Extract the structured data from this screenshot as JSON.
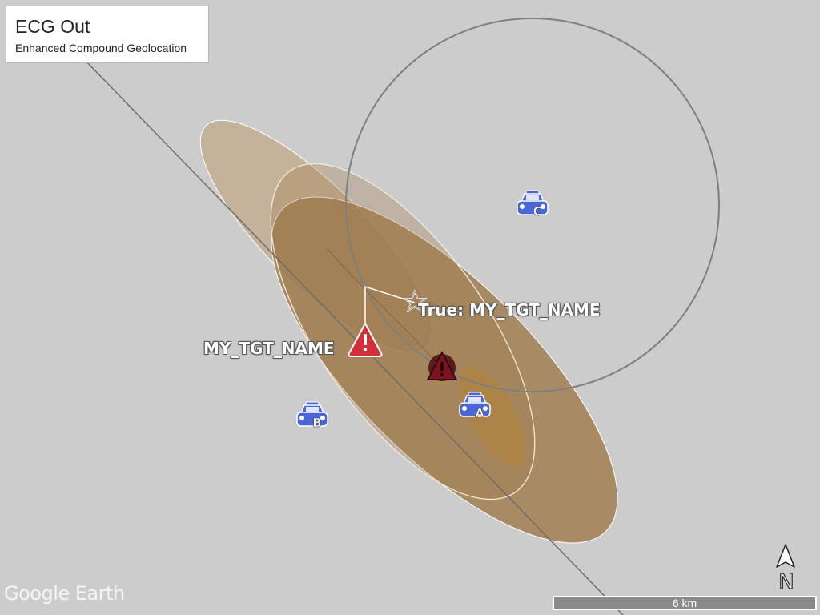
{
  "panel": {
    "title": "ECG Out",
    "subtitle": "Enhanced Compound Geolocation"
  },
  "labels": {
    "target": "MY_TGT_NAME",
    "true_target": "True: MY_TGT_NAME"
  },
  "sensors": {
    "a": "A",
    "b": "B",
    "c": "C"
  },
  "watermark": "Google Earth",
  "scale_bar": {
    "label": "6 km"
  },
  "north_arrow": {
    "label": "N"
  },
  "colors": {
    "background": "#cccccc",
    "ellipse_outer": "#a07c4e",
    "ellipse_light": "#c8b39a",
    "warning_red": "#d32f3c",
    "warning_dark": "#6b1018",
    "sensor_blue": "#4a66d9"
  }
}
